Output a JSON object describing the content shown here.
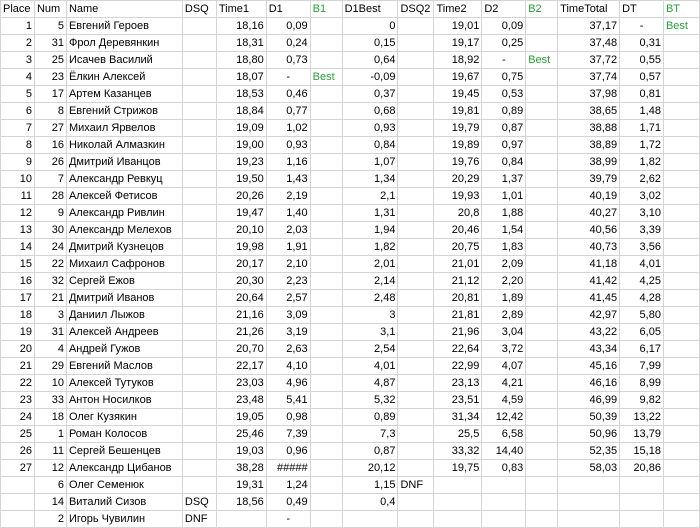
{
  "columns": [
    "Place",
    "Num",
    "Name",
    "DSQ",
    "Time1",
    "D1",
    "B1",
    "D1Best",
    "DSQ2",
    "Time2",
    "D2",
    "B2",
    "TimeTotal",
    "DT",
    "BT"
  ],
  "rows": [
    [
      "1",
      "5",
      "Евгений Героев",
      "",
      "18,16",
      "0,09",
      "",
      "0",
      "",
      "19,01",
      "0,09",
      "",
      "37,17",
      "-",
      "Best"
    ],
    [
      "2",
      "31",
      "Фрол Деревянкин",
      "",
      "18,31",
      "0,24",
      "",
      "0,15",
      "",
      "19,17",
      "0,25",
      "",
      "37,48",
      "0,31",
      ""
    ],
    [
      "3",
      "25",
      "Исачев Василий",
      "",
      "18,80",
      "0,73",
      "",
      "0,64",
      "",
      "18,92",
      "-",
      "Best",
      "37,72",
      "0,55",
      ""
    ],
    [
      "4",
      "23",
      "Ёлкин Алексей",
      "",
      "18,07",
      "-",
      "Best",
      "-0,09",
      "",
      "19,67",
      "0,75",
      "",
      "37,74",
      "0,57",
      ""
    ],
    [
      "5",
      "17",
      "Артем Казанцев",
      "",
      "18,53",
      "0,46",
      "",
      "0,37",
      "",
      "19,45",
      "0,53",
      "",
      "37,98",
      "0,81",
      ""
    ],
    [
      "6",
      "8",
      "Евгений Стрижов",
      "",
      "18,84",
      "0,77",
      "",
      "0,68",
      "",
      "19,81",
      "0,89",
      "",
      "38,65",
      "1,48",
      ""
    ],
    [
      "7",
      "27",
      "Михаил Ярвелов",
      "",
      "19,09",
      "1,02",
      "",
      "0,93",
      "",
      "19,79",
      "0,87",
      "",
      "38,88",
      "1,71",
      ""
    ],
    [
      "8",
      "16",
      "Николай Алмазкин",
      "",
      "19,00",
      "0,93",
      "",
      "0,84",
      "",
      "19,89",
      "0,97",
      "",
      "38,89",
      "1,72",
      ""
    ],
    [
      "9",
      "26",
      "Дмитрий Иванцов",
      "",
      "19,23",
      "1,16",
      "",
      "1,07",
      "",
      "19,76",
      "0,84",
      "",
      "38,99",
      "1,82",
      ""
    ],
    [
      "10",
      "7",
      "Александр Ревкуц",
      "",
      "19,50",
      "1,43",
      "",
      "1,34",
      "",
      "20,29",
      "1,37",
      "",
      "39,79",
      "2,62",
      ""
    ],
    [
      "11",
      "28",
      "Алексей Фетисов",
      "",
      "20,26",
      "2,19",
      "",
      "2,1",
      "",
      "19,93",
      "1,01",
      "",
      "40,19",
      "3,02",
      ""
    ],
    [
      "12",
      "9",
      "Александр Ривлин",
      "",
      "19,47",
      "1,40",
      "",
      "1,31",
      "",
      "20,8",
      "1,88",
      "",
      "40,27",
      "3,10",
      ""
    ],
    [
      "13",
      "30",
      "Александр Мелехов",
      "",
      "20,10",
      "2,03",
      "",
      "1,94",
      "",
      "20,46",
      "1,54",
      "",
      "40,56",
      "3,39",
      ""
    ],
    [
      "14",
      "24",
      "Дмитрий Кузнецов",
      "",
      "19,98",
      "1,91",
      "",
      "1,82",
      "",
      "20,75",
      "1,83",
      "",
      "40,73",
      "3,56",
      ""
    ],
    [
      "15",
      "22",
      "Михаил Сафронов",
      "",
      "20,17",
      "2,10",
      "",
      "2,01",
      "",
      "21,01",
      "2,09",
      "",
      "41,18",
      "4,01",
      ""
    ],
    [
      "16",
      "32",
      "Сергей Ежов",
      "",
      "20,30",
      "2,23",
      "",
      "2,14",
      "",
      "21,12",
      "2,20",
      "",
      "41,42",
      "4,25",
      ""
    ],
    [
      "17",
      "21",
      "Дмитрий Иванов",
      "",
      "20,64",
      "2,57",
      "",
      "2,48",
      "",
      "20,81",
      "1,89",
      "",
      "41,45",
      "4,28",
      ""
    ],
    [
      "18",
      "3",
      "Даниил Лыжов",
      "",
      "21,16",
      "3,09",
      "",
      "3",
      "",
      "21,81",
      "2,89",
      "",
      "42,97",
      "5,80",
      ""
    ],
    [
      "19",
      "31",
      "Алексей Андреев",
      "",
      "21,26",
      "3,19",
      "",
      "3,1",
      "",
      "21,96",
      "3,04",
      "",
      "43,22",
      "6,05",
      ""
    ],
    [
      "20",
      "4",
      "Андрей Гужов",
      "",
      "20,70",
      "2,63",
      "",
      "2,54",
      "",
      "22,64",
      "3,72",
      "",
      "43,34",
      "6,17",
      ""
    ],
    [
      "21",
      "29",
      "Евгений Маслов",
      "",
      "22,17",
      "4,10",
      "",
      "4,01",
      "",
      "22,99",
      "4,07",
      "",
      "45,16",
      "7,99",
      ""
    ],
    [
      "22",
      "10",
      "Алексей Тутуков",
      "",
      "23,03",
      "4,96",
      "",
      "4,87",
      "",
      "23,13",
      "4,21",
      "",
      "46,16",
      "8,99",
      ""
    ],
    [
      "23",
      "33",
      "Антон Носилков",
      "",
      "23,48",
      "5,41",
      "",
      "5,32",
      "",
      "23,51",
      "4,59",
      "",
      "46,99",
      "9,82",
      ""
    ],
    [
      "24",
      "18",
      "Олег Кузякин",
      "",
      "19,05",
      "0,98",
      "",
      "0,89",
      "",
      "31,34",
      "12,42",
      "",
      "50,39",
      "13,22",
      ""
    ],
    [
      "25",
      "1",
      "Роман Колосов",
      "",
      "25,46",
      "7,39",
      "",
      "7,3",
      "",
      "25,5",
      "6,58",
      "",
      "50,96",
      "13,79",
      ""
    ],
    [
      "26",
      "11",
      "Сергей Бешенцев",
      "",
      "19,03",
      "0,96",
      "",
      "0,87",
      "",
      "33,32",
      "14,40",
      "",
      "52,35",
      "15,18",
      ""
    ],
    [
      "27",
      "12",
      "Александр Цибанов",
      "",
      "38,28",
      "#####",
      "",
      "20,12",
      "",
      "19,75",
      "0,83",
      "",
      "58,03",
      "20,86",
      ""
    ],
    [
      "",
      "6",
      "Олег Семенюк",
      "",
      "19,31",
      "1,24",
      "",
      "1,15",
      "DNF",
      "",
      "",
      "",
      "",
      "",
      ""
    ],
    [
      "",
      "14",
      "Виталий Сизов",
      "DSQ",
      "18,56",
      "0,49",
      "",
      "0,4",
      "",
      "",
      "",
      "",
      "",
      "",
      ""
    ],
    [
      "",
      "2",
      "Игорь Чувилин",
      "DNF",
      "",
      "-",
      "",
      "",
      "",
      "",
      "",
      "",
      "",
      "",
      ""
    ]
  ],
  "colors": {
    "best_green": "#2e9b3c",
    "gridline": "#d4d4d4"
  }
}
